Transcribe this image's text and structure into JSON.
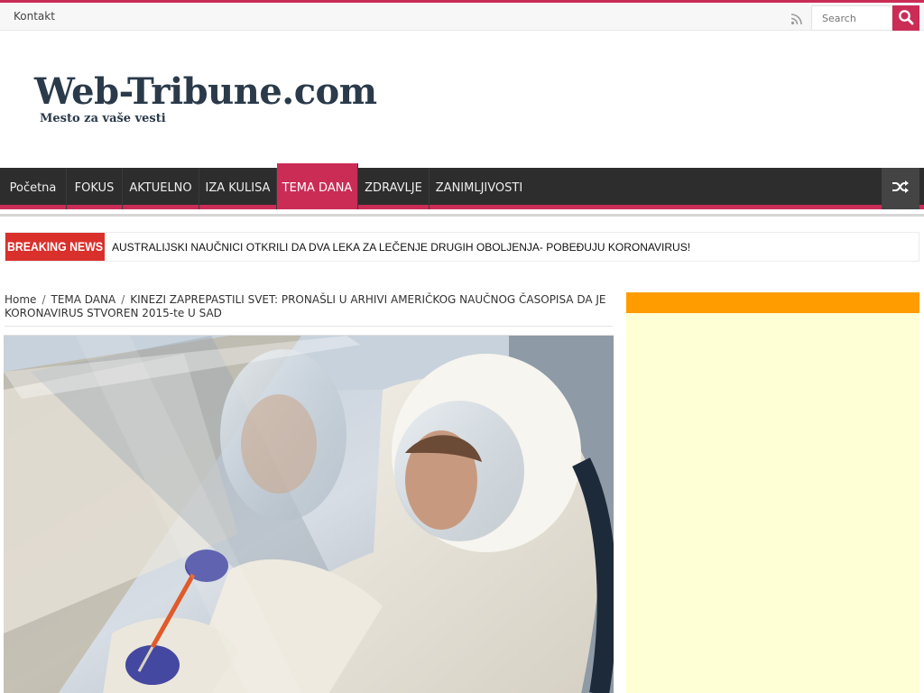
{
  "topbar": {
    "link": "Kontakt",
    "search_placeholder": "Search",
    "rss_icon": "rss-icon",
    "search_icon": "search-icon"
  },
  "logo": {
    "title": "Web-Tribune.com",
    "tagline": "Mesto za vaše vesti"
  },
  "nav": {
    "items": [
      {
        "label": "Početna"
      },
      {
        "label": "FOKUS"
      },
      {
        "label": "AKTUELNO"
      },
      {
        "label": "IZA KULISA"
      },
      {
        "label": "TEMA DANA"
      },
      {
        "label": "ZDRAVLJE"
      },
      {
        "label": "ZANIMLJIVOSTI"
      }
    ],
    "active": "TEMA DANA",
    "shuffle_icon": "shuffle-icon"
  },
  "breaking": {
    "label": "BREAKING NEWS",
    "headline": "AUSTRALIJSKI NAUČNICI OTKRILI DA DVA LEKA ZA LEČENJE DRUGIH OBOLJENJA- POBEĐUJU KORONAVIRUS!"
  },
  "breadcrumb": {
    "home": "Home",
    "separator": "/",
    "category": "TEMA DANA",
    "current": "KINEZI ZAPREPASTILI SVET: PRONAŠLI U ARHIVI AMERIČKOG NAUČNOG ČASOPISA DA JE KORONAVIRUS STVOREN 2015-te U SAD"
  },
  "colors": {
    "accent": "#ca2c56",
    "nav_bg": "#2d2d2d",
    "breaking_red": "#d9302c",
    "ad_orange": "#ff9c00",
    "ad_bg": "#ffffd6"
  }
}
